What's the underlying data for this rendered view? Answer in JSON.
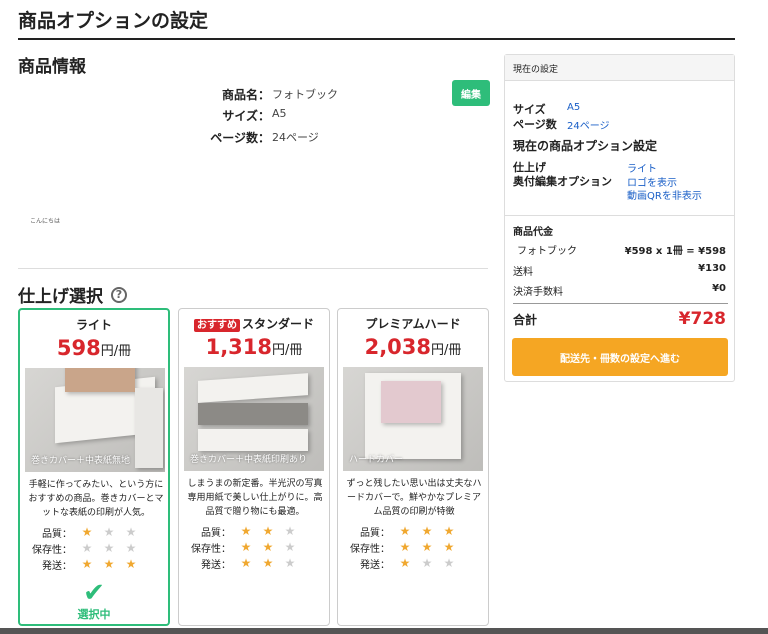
{
  "page": {
    "title": "商品オプションの設定"
  },
  "product_info": {
    "title": "商品情報",
    "rows": [
      {
        "label": "商品名：",
        "value": "フォトブック"
      },
      {
        "label": "サイズ：",
        "value": "A5"
      },
      {
        "label": "ページ数：",
        "value": "24ページ"
      }
    ],
    "edit_label": "編集",
    "note": "こんにちは"
  },
  "finish": {
    "title": "仕上げ選択",
    "help_icon": "?",
    "rating_labels": [
      "品質：",
      "保存性：",
      "発送："
    ],
    "selected_label": "選択中",
    "cards": [
      {
        "name": "ライト",
        "badge": "",
        "price": "598",
        "unit": "円/冊",
        "caption": "巻きカバー＋中表紙無地",
        "desc": "手軽に作ってみたい、という方におすすめの商品。巻きカバーとマットな表紙の印刷が人気。",
        "ratings": [
          1,
          0,
          3
        ],
        "selected": true
      },
      {
        "name": "スタンダード",
        "badge": "おすすめ",
        "price": "1,318",
        "unit": "円/冊",
        "caption": "巻きカバー＋中表紙印刷あり",
        "desc": "しまうまの新定番。半光沢の写真専用用紙で美しい仕上がりに。高品質で贈り物にも最適。",
        "ratings": [
          2,
          2,
          2
        ],
        "selected": false
      },
      {
        "name": "プレミアムハード",
        "badge": "",
        "price": "2,038",
        "unit": "円/冊",
        "caption": "ハードカバー",
        "desc": "ずっと残したい思い出は丈夫なハードカバーで。鮮やかなプレミアム品質の印刷が特徴",
        "ratings": [
          3,
          3,
          1
        ],
        "selected": false
      }
    ]
  },
  "side": {
    "header": "現在の設定",
    "size_label": "サイズ",
    "size_value": "A5",
    "pages_label": "ページ数",
    "pages_value": "24ページ",
    "options_title": "現在の商品オプション設定",
    "finish_label": "仕上げ",
    "finish_value": "ライト",
    "edit_option_label": "奥付編集オプション",
    "edit_option_values": [
      "ロゴを表示",
      "動画QRを非表示"
    ],
    "cost_title": "商品代金",
    "item_name": "フォトブック",
    "item_calc": "¥598 x 1冊 = ¥598",
    "shipping_label": "送料",
    "shipping_value": "¥130",
    "fee_label": "決済手数料",
    "fee_value": "¥0",
    "total_label": "合計",
    "total_value": "¥728",
    "next_button": "配送先・冊数の設定へ進む"
  },
  "colors": {
    "accent_green": "#2ebd7a",
    "price_red": "#d8262c",
    "button_orange": "#f5a623",
    "link_blue": "#1a5fc7"
  }
}
